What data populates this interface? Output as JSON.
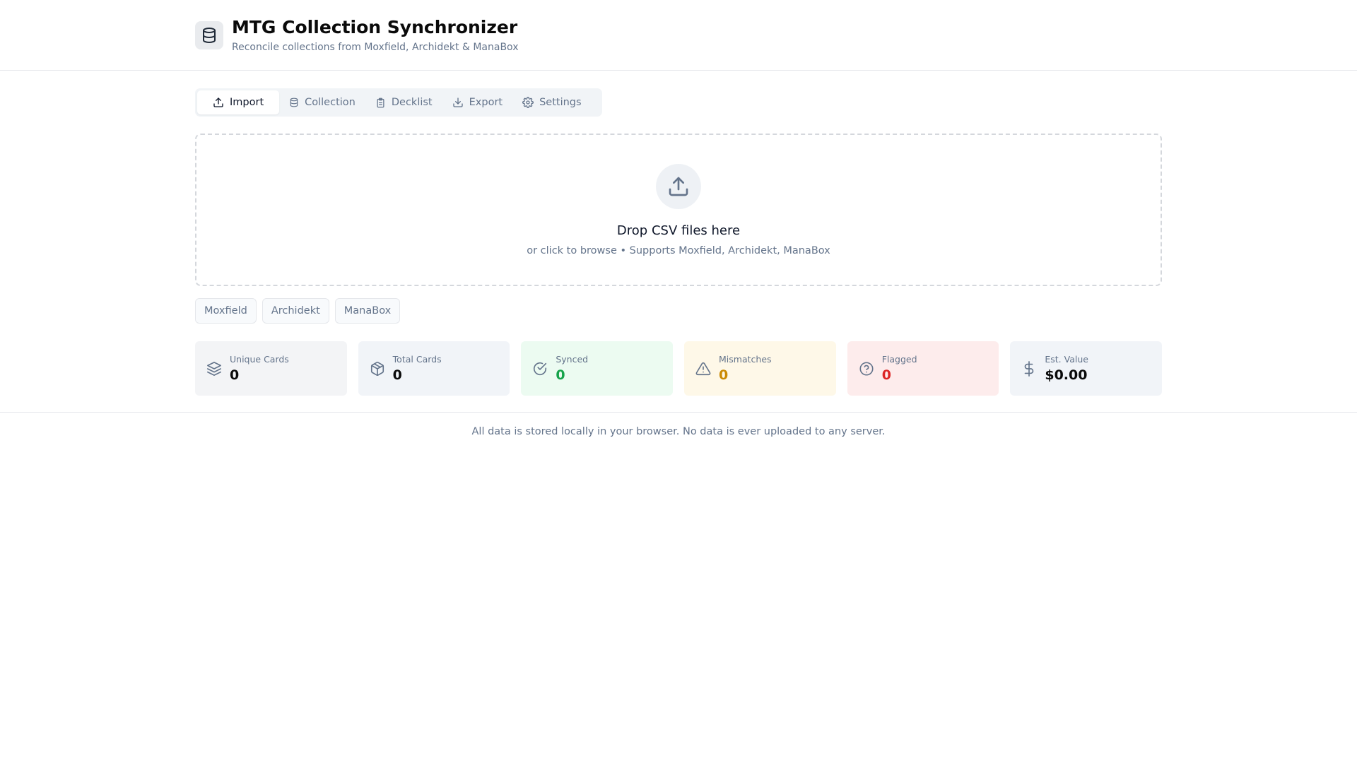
{
  "header": {
    "title": "MTG Collection Synchronizer",
    "subtitle": "Reconcile collections from Moxfield, Archidekt & ManaBox",
    "logo_icon": "database-icon"
  },
  "tabs": [
    {
      "label": "Import",
      "icon": "upload-icon",
      "active": true
    },
    {
      "label": "Collection",
      "icon": "database-icon",
      "active": false
    },
    {
      "label": "Decklist",
      "icon": "clipboard-icon",
      "active": false
    },
    {
      "label": "Export",
      "icon": "download-icon",
      "active": false
    },
    {
      "label": "Settings",
      "icon": "gear-icon",
      "active": false
    }
  ],
  "dropzone": {
    "title": "Drop CSV files here",
    "subtitle": "or click to browse • Supports Moxfield, Archidekt, ManaBox",
    "icon": "upload-icon"
  },
  "sources": [
    "Moxfield",
    "Archidekt",
    "ManaBox"
  ],
  "stats": [
    {
      "label": "Unique Cards",
      "value": "0",
      "icon": "layers-icon",
      "bg": "#f3f4f6",
      "color": "#0a0a0a"
    },
    {
      "label": "Total Cards",
      "value": "0",
      "icon": "package-icon",
      "bg": "#f1f4f8",
      "color": "#0a0a0a"
    },
    {
      "label": "Synced",
      "value": "0",
      "icon": "check-circle-icon",
      "bg": "#ecfbf1",
      "color": "#16a34a"
    },
    {
      "label": "Mismatches",
      "value": "0",
      "icon": "warning-icon",
      "bg": "#fef8e8",
      "color": "#ca8a04"
    },
    {
      "label": "Flagged",
      "value": "0",
      "icon": "help-circle-icon",
      "bg": "#fdecec",
      "color": "#dc2626"
    },
    {
      "label": "Est. Value",
      "value": "$0.00",
      "icon": "dollar-icon",
      "bg": "#f1f4f8",
      "color": "#0a0a0a"
    }
  ],
  "footer": {
    "text": "All data is stored locally in your browser. No data is ever uploaded to any server."
  }
}
